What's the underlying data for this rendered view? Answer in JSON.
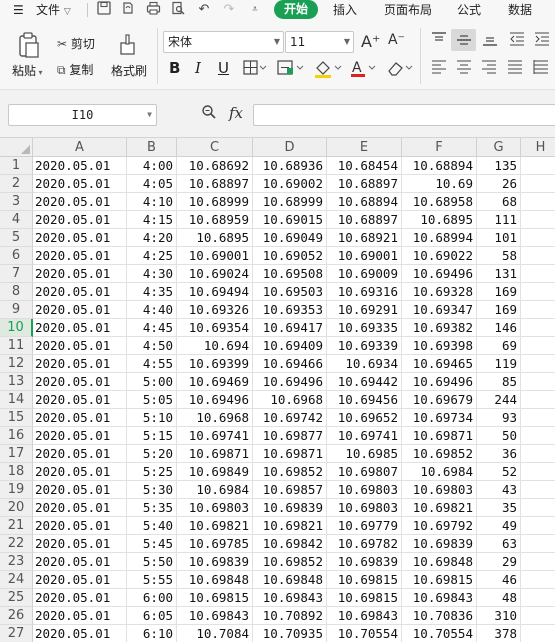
{
  "menu": {
    "file_label": "文件",
    "tabs": [
      "开始",
      "插入",
      "页面布局",
      "公式",
      "数据"
    ]
  },
  "ribbon": {
    "paste_label": "粘贴",
    "cut_label": "剪切",
    "copy_label": "复制",
    "format_painter_label": "格式刷",
    "font_name": "宋体",
    "font_size": "11",
    "bold": "B",
    "italic": "I",
    "underline": "U",
    "grow_font": "A⁺",
    "shrink_font": "A⁻"
  },
  "formula_bar": {
    "name_box": "I10",
    "fx_label": "fx",
    "formula": ""
  },
  "grid": {
    "columns": [
      "A",
      "B",
      "C",
      "D",
      "E",
      "F",
      "G",
      "H"
    ],
    "active_row": 10,
    "rows": [
      {
        "n": "1",
        "cells": [
          "2020.05.01",
          "4:00",
          "10.68692",
          "10.68936",
          "10.68454",
          "10.68894",
          "135"
        ]
      },
      {
        "n": "2",
        "cells": [
          "2020.05.01",
          "4:05",
          "10.68897",
          "10.69002",
          "10.68897",
          "10.69",
          "26"
        ]
      },
      {
        "n": "3",
        "cells": [
          "2020.05.01",
          "4:10",
          "10.68999",
          "10.68999",
          "10.68894",
          "10.68958",
          "68"
        ]
      },
      {
        "n": "4",
        "cells": [
          "2020.05.01",
          "4:15",
          "10.68959",
          "10.69015",
          "10.68897",
          "10.6895",
          "111"
        ]
      },
      {
        "n": "5",
        "cells": [
          "2020.05.01",
          "4:20",
          "10.6895",
          "10.69049",
          "10.68921",
          "10.68994",
          "101"
        ]
      },
      {
        "n": "6",
        "cells": [
          "2020.05.01",
          "4:25",
          "10.69001",
          "10.69052",
          "10.69001",
          "10.69022",
          "58"
        ]
      },
      {
        "n": "7",
        "cells": [
          "2020.05.01",
          "4:30",
          "10.69024",
          "10.69508",
          "10.69009",
          "10.69496",
          "131"
        ]
      },
      {
        "n": "8",
        "cells": [
          "2020.05.01",
          "4:35",
          "10.69494",
          "10.69503",
          "10.69316",
          "10.69328",
          "169"
        ]
      },
      {
        "n": "9",
        "cells": [
          "2020.05.01",
          "4:40",
          "10.69326",
          "10.69353",
          "10.69291",
          "10.69347",
          "169"
        ]
      },
      {
        "n": "10",
        "cells": [
          "2020.05.01",
          "4:45",
          "10.69354",
          "10.69417",
          "10.69335",
          "10.69382",
          "146"
        ]
      },
      {
        "n": "11",
        "cells": [
          "2020.05.01",
          "4:50",
          "10.694",
          "10.69409",
          "10.69339",
          "10.69398",
          "69"
        ]
      },
      {
        "n": "12",
        "cells": [
          "2020.05.01",
          "4:55",
          "10.69399",
          "10.69466",
          "10.6934",
          "10.69465",
          "119"
        ]
      },
      {
        "n": "13",
        "cells": [
          "2020.05.01",
          "5:00",
          "10.69469",
          "10.69496",
          "10.69442",
          "10.69496",
          "85"
        ]
      },
      {
        "n": "14",
        "cells": [
          "2020.05.01",
          "5:05",
          "10.69496",
          "10.6968",
          "10.69456",
          "10.69679",
          "244"
        ]
      },
      {
        "n": "15",
        "cells": [
          "2020.05.01",
          "5:10",
          "10.6968",
          "10.69742",
          "10.69652",
          "10.69734",
          "93"
        ]
      },
      {
        "n": "16",
        "cells": [
          "2020.05.01",
          "5:15",
          "10.69741",
          "10.69877",
          "10.69741",
          "10.69871",
          "50"
        ]
      },
      {
        "n": "17",
        "cells": [
          "2020.05.01",
          "5:20",
          "10.69871",
          "10.69871",
          "10.6985",
          "10.69852",
          "36"
        ]
      },
      {
        "n": "18",
        "cells": [
          "2020.05.01",
          "5:25",
          "10.69849",
          "10.69852",
          "10.69807",
          "10.6984",
          "52"
        ]
      },
      {
        "n": "19",
        "cells": [
          "2020.05.01",
          "5:30",
          "10.6984",
          "10.69857",
          "10.69803",
          "10.69803",
          "43"
        ]
      },
      {
        "n": "20",
        "cells": [
          "2020.05.01",
          "5:35",
          "10.69803",
          "10.69839",
          "10.69803",
          "10.69821",
          "35"
        ]
      },
      {
        "n": "21",
        "cells": [
          "2020.05.01",
          "5:40",
          "10.69821",
          "10.69821",
          "10.69779",
          "10.69792",
          "49"
        ]
      },
      {
        "n": "22",
        "cells": [
          "2020.05.01",
          "5:45",
          "10.69785",
          "10.69842",
          "10.69782",
          "10.69839",
          "63"
        ]
      },
      {
        "n": "23",
        "cells": [
          "2020.05.01",
          "5:50",
          "10.69839",
          "10.69852",
          "10.69839",
          "10.69848",
          "29"
        ]
      },
      {
        "n": "24",
        "cells": [
          "2020.05.01",
          "5:55",
          "10.69848",
          "10.69848",
          "10.69815",
          "10.69815",
          "46"
        ]
      },
      {
        "n": "25",
        "cells": [
          "2020.05.01",
          "6:00",
          "10.69815",
          "10.69843",
          "10.69815",
          "10.69843",
          "48"
        ]
      },
      {
        "n": "26",
        "cells": [
          "2020.05.01",
          "6:05",
          "10.69843",
          "10.70892",
          "10.69843",
          "10.70836",
          "310"
        ]
      },
      {
        "n": "27",
        "cells": [
          "2020.05.01",
          "6:10",
          "10.7084",
          "10.70935",
          "10.70554",
          "10.70554",
          "378"
        ]
      }
    ]
  },
  "colors": {
    "accent": "#1aa054",
    "header_bg": "#efefef",
    "gridline": "#e1e1e1"
  }
}
